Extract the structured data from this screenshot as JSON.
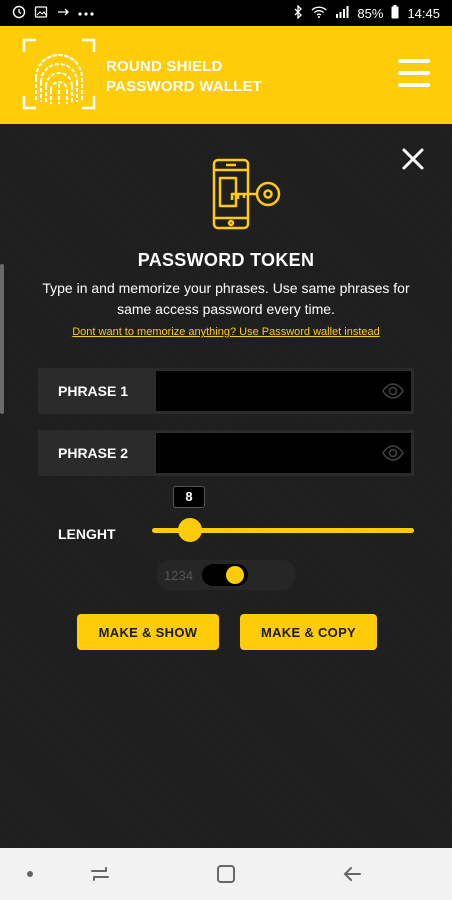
{
  "status_bar": {
    "battery": "85%",
    "time": "14:45"
  },
  "header": {
    "brand_line1": "ROUND SHIELD",
    "brand_line2": "PASSWORD WALLET",
    "logo_icon": "fingerprint-icon",
    "menu_icon": "hamburger-menu-icon"
  },
  "colors": {
    "accent": "#ffcc0a",
    "background": "#1e1e1e",
    "input_bg": "#000000"
  },
  "main": {
    "close_icon": "close-icon",
    "hero_icon": "phone-key-icon",
    "title": "PASSWORD TOKEN",
    "description": "Type in and memorize your phrases. Use same phrases for same access password every time.",
    "link": "Dont want to memorize anything? Use Password wallet instead",
    "phrase1": {
      "label": "PHRASE 1",
      "value": ""
    },
    "phrase2": {
      "label": "PHRASE 2",
      "value": ""
    },
    "length": {
      "label": "LENGHT",
      "value": "8",
      "fraction": 0.14
    },
    "numbers_toggle": {
      "label": "1234",
      "on": true
    },
    "make_show_label": "MAKE & SHOW",
    "make_copy_label": "MAKE & COPY"
  }
}
